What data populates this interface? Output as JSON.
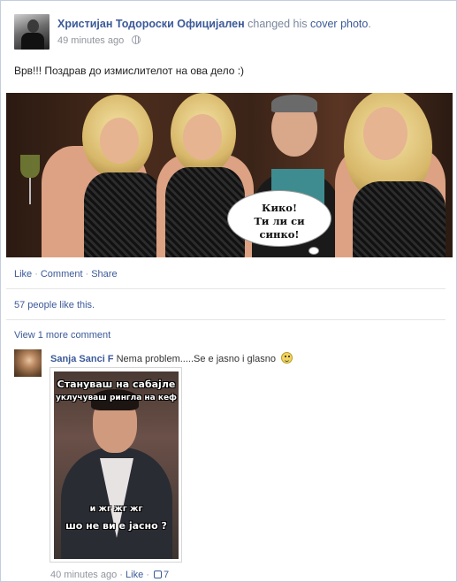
{
  "post": {
    "author": "Христијан Тодороски Официјален",
    "action_prefix": "changed his",
    "action_link": "cover photo",
    "action_suffix": ".",
    "time": "49 minutes ago",
    "text": "Врв!!! Поздрав до измислителот на ова дело :)",
    "cover_bubble_line1": "Кико!",
    "cover_bubble_line2": "Ти ли си",
    "cover_bubble_line3": "синко!"
  },
  "actions": {
    "like": "Like",
    "comment": "Comment",
    "share": "Share",
    "separator": "·"
  },
  "likes_summary": "57 people like this.",
  "view_more": "View 1 more comment",
  "comment": {
    "author": "Sanja Sanci F",
    "text": "Nema problem.....Se e jasno i glasno",
    "photo_caption_1": "Стануваш на сабајле",
    "photo_caption_2": "уклучуваш рингла на кеф",
    "photo_caption_3": "и жг жг жг",
    "photo_caption_4": "шо не ви е јасно ?",
    "time": "40 minutes ago",
    "like": "Like",
    "like_count": "7"
  },
  "colors": {
    "link": "#3b5998",
    "meta": "#90949c",
    "border": "#c4cde0"
  },
  "icons": [
    "globe-icon",
    "smiley-icon",
    "thumbs-up-icon"
  ]
}
